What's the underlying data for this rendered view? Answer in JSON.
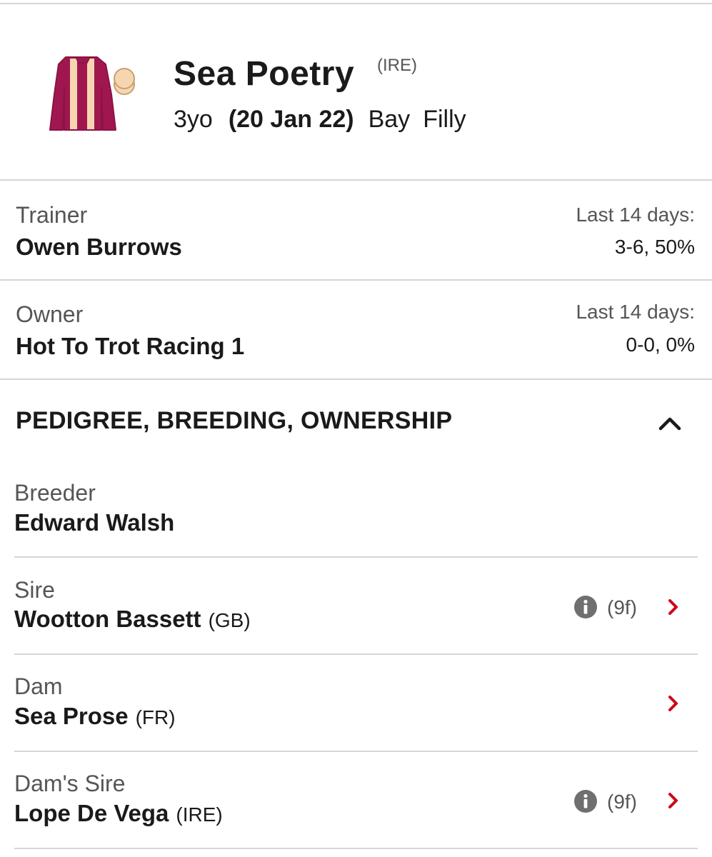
{
  "horse": {
    "name": "Sea Poetry",
    "country": "(IRE)",
    "age": "3yo",
    "dob": "(20 Jan 22)",
    "colour": "Bay",
    "sex": "Filly",
    "silk_colors": {
      "body": "#a0174f",
      "stripe": "#f6d6b0",
      "cap": "#f6d6b0",
      "outline": "#8a1344"
    }
  },
  "connections": [
    {
      "label": "Trainer",
      "name": "Owen Burrows",
      "stat_label": "Last 14 days:",
      "stat_value": "3-6, 50%"
    },
    {
      "label": "Owner",
      "name": "Hot To Trot Racing 1",
      "stat_label": "Last 14 days:",
      "stat_value": "0-0, 0%"
    }
  ],
  "section": {
    "title": "PEDIGREE, BREEDING, OWNERSHIP",
    "state": "expanded",
    "toggle_icon": "chevron-up-icon"
  },
  "pedigree": [
    {
      "label": "Breeder",
      "name": "Edward Walsh",
      "suffix": ""
    },
    {
      "label": "Sire",
      "name": "Wootton Bassett",
      "suffix": "(GB)",
      "distance": "(9f)",
      "info_icon": "info-icon",
      "link_icon": "chevron-right-icon"
    },
    {
      "label": "Dam",
      "name": "Sea Prose",
      "suffix": "(FR)",
      "link_icon": "chevron-right-icon"
    },
    {
      "label": "Dam's Sire",
      "name": "Lope De Vega",
      "suffix": "(IRE)",
      "distance": "(9f)",
      "info_icon": "info-icon",
      "link_icon": "chevron-right-icon"
    }
  ],
  "colors": {
    "accent": "#d0021b",
    "divider": "#d6d6d6",
    "muted_text": "#555555",
    "info_icon": "#6f6f6f"
  }
}
